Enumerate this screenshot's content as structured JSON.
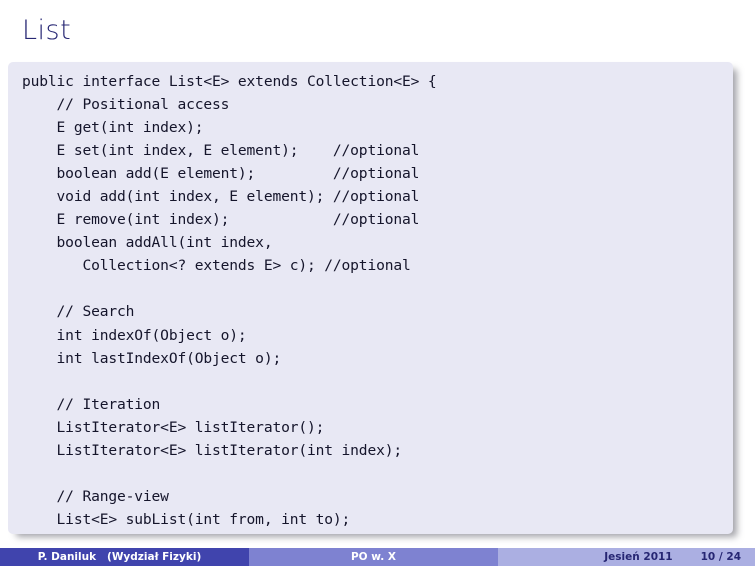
{
  "slide": {
    "title": "List",
    "code": "public interface List<E> extends Collection<E> {\n    // Positional access\n    E get(int index);\n    E set(int index, E element);    //optional\n    boolean add(E element);         //optional\n    void add(int index, E element); //optional\n    E remove(int index);            //optional\n    boolean addAll(int index,\n       Collection<? extends E> c); //optional\n\n    // Search\n    int indexOf(Object o);\n    int lastIndexOf(Object o);\n\n    // Iteration\n    ListIterator<E> listIterator();\n    ListIterator<E> listIterator(int index);\n\n    // Range-view\n    List<E> subList(int from, int to);\n}",
    "code_lines": [
      "public interface List<E> extends Collection<E> {",
      "    // Positional access",
      "    E get(int index);",
      "    E set(int index, E element);    //optional",
      "    boolean add(E element);         //optional",
      "    void add(int index, E element); //optional",
      "    E remove(int index);            //optional",
      "    boolean addAll(int index,",
      "       Collection<? extends E> c); //optional",
      "",
      "    // Search",
      "    int indexOf(Object o);",
      "    int lastIndexOf(Object o);",
      "",
      "    // Iteration",
      "    ListIterator<E> listIterator();",
      "    ListIterator<E> listIterator(int index);",
      "",
      "    // Range-view",
      "    List<E> subList(int from, int to);",
      "}"
    ]
  },
  "footer": {
    "author": "P. Daniluk   (Wydział Fizyki)",
    "center": "PO w. X",
    "term": "Jesień 2011",
    "page": "10 / 24"
  },
  "colors": {
    "title_text": "#282874",
    "code_background": "#e8e8f4",
    "code_text": "#15152b",
    "footer_left_bg": "#4044ad",
    "footer_center_bg": "#7e82d1",
    "footer_right_bg": "#abafe2",
    "footer_right_text": "#262673",
    "page_background": "#ffffff"
  }
}
